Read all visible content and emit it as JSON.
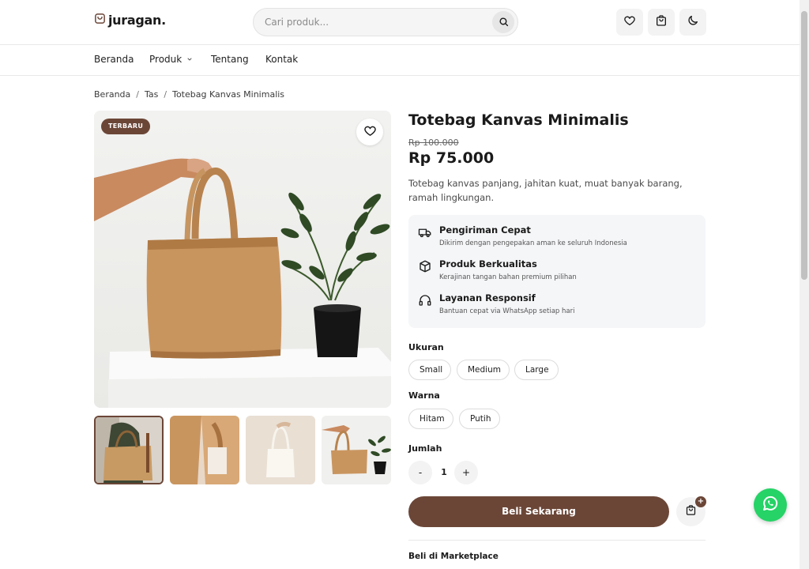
{
  "header": {
    "logo_text": "juragan.",
    "search_placeholder": "Cari produk..."
  },
  "nav": {
    "items": [
      {
        "label": "Beranda"
      },
      {
        "label": "Produk"
      },
      {
        "label": "Tentang"
      },
      {
        "label": "Kontak"
      }
    ]
  },
  "breadcrumb": {
    "items": [
      "Beranda",
      "Tas",
      "Totebag Kanvas Minimalis"
    ],
    "separator": "/"
  },
  "gallery": {
    "badge": "TERBARU",
    "thumbnails_count": 4
  },
  "product": {
    "title": "Totebag Kanvas Minimalis",
    "old_price": "Rp 100.000",
    "price": "Rp 75.000",
    "description": "Totebag kanvas panjang, jahitan kuat, muat banyak barang, ramah lingkungan."
  },
  "features": [
    {
      "icon": "truck-icon",
      "title": "Pengiriman Cepat",
      "subtitle": "Dikirim dengan pengepakan aman ke seluruh Indonesia"
    },
    {
      "icon": "box-icon",
      "title": "Produk Berkualitas",
      "subtitle": "Kerajinan tangan bahan premium pilihan"
    },
    {
      "icon": "headphones-icon",
      "title": "Layanan Responsif",
      "subtitle": "Bantuan cepat via WhatsApp setiap hari"
    }
  ],
  "options": {
    "size_label": "Ukuran",
    "sizes": [
      "Small",
      "Medium",
      "Large"
    ],
    "color_label": "Warna",
    "colors": [
      "Hitam",
      "Putih"
    ],
    "qty_label": "Jumlah",
    "qty_minus": "-",
    "qty_value": "1",
    "qty_plus": "+"
  },
  "actions": {
    "buy_label": "Beli Sekarang",
    "add_badge": "+"
  },
  "marketplace": {
    "label": "Beli di Marketplace"
  },
  "colors": {
    "accent": "#6b4637",
    "whatsapp": "#25d366"
  }
}
